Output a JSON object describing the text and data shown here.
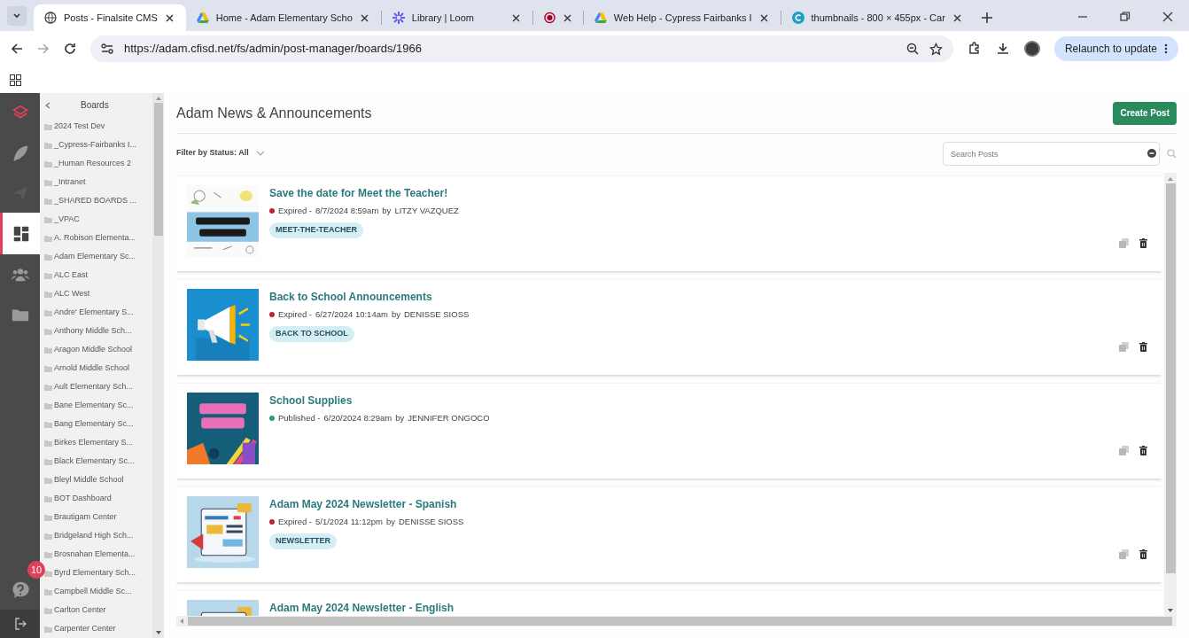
{
  "browser": {
    "tabs": [
      {
        "title": "Posts - Finalsite CMS",
        "selected": true
      },
      {
        "title": "Home - Adam Elementary Scho",
        "selected": false
      },
      {
        "title": "Library | Loom",
        "selected": false
      },
      {
        "selected": false
      },
      {
        "title": "Web Help - Cypress Fairbanks I",
        "selected": false
      },
      {
        "title": "thumbnails - 800 × 455px - Car",
        "selected": false
      }
    ],
    "url": "https://adam.cfisd.net/fs/admin/post-manager/boards/1966",
    "relaunch": "Relaunch to update"
  },
  "rail": {
    "items": [
      {
        "selected": false
      },
      {
        "selected": false
      },
      {
        "selected": false
      },
      {
        "selected": true
      },
      {
        "selected": false
      },
      {
        "selected": false
      }
    ],
    "help_badge": "10"
  },
  "boards": {
    "title": "Boards",
    "items": [
      "2024 Test Dev",
      "_Cypress-Fairbanks I...",
      "_Human Resources 2",
      "_Intranet",
      "_SHARED BOARDS ...",
      "_VPAC",
      "A. Robison Elementa...",
      "Adam Elementary Sc...",
      "ALC East",
      "ALC West",
      "Andre' Elementary S...",
      "Anthony Middle Sch...",
      "Aragon Middle School",
      "Arnold Middle School",
      "Ault Elementary Sch...",
      "Bane Elementary Sc...",
      "Bang Elementary Sc...",
      "Birkes Elementary S...",
      "Black Elementary Sc...",
      "Bleyl Middle School",
      "BOT Dashboard",
      "Brautigam Center",
      "Bridgeland High Sch...",
      "Brosnahan Elementa...",
      "Byrd Elementary Sch...",
      "Campbell Middle Sc...",
      "Carlton Center",
      "Carpenter Center"
    ]
  },
  "main": {
    "title": "Adam News & Announcements",
    "create_button": "Create Post",
    "filter": "Filter by Status: All",
    "search": {
      "placeholder": "Search Posts"
    },
    "posts": [
      {
        "title": "Save the date for Meet the Teacher!",
        "status": "Expired -",
        "color": "#c0213a",
        "date": "8/7/2024 8:59am",
        "by": "by",
        "author": "LITZY VAZQUEZ",
        "tag": "MEET-THE-TEACHER"
      },
      {
        "title": "Back to School Announcements",
        "status": "Expired -",
        "color": "#c0213a",
        "date": "6/27/2024 10:14am",
        "by": "by",
        "author": "DENISSE SIOSS",
        "tag": "BACK TO SCHOOL"
      },
      {
        "title": "School Supplies",
        "status": "Published -",
        "color": "#2e9e6a",
        "date": "6/20/2024 8:29am",
        "by": "by",
        "author": "JENNIFER ONGOCO"
      },
      {
        "title": "Adam May 2024 Newsletter - Spanish",
        "status": "Expired -",
        "color": "#c0213a",
        "date": "5/1/2024 11:12pm",
        "by": "by",
        "author": "DENISSE SIOSS",
        "tag": "NEWSLETTER"
      },
      {
        "title": "Adam May 2024 Newsletter - English"
      }
    ]
  }
}
